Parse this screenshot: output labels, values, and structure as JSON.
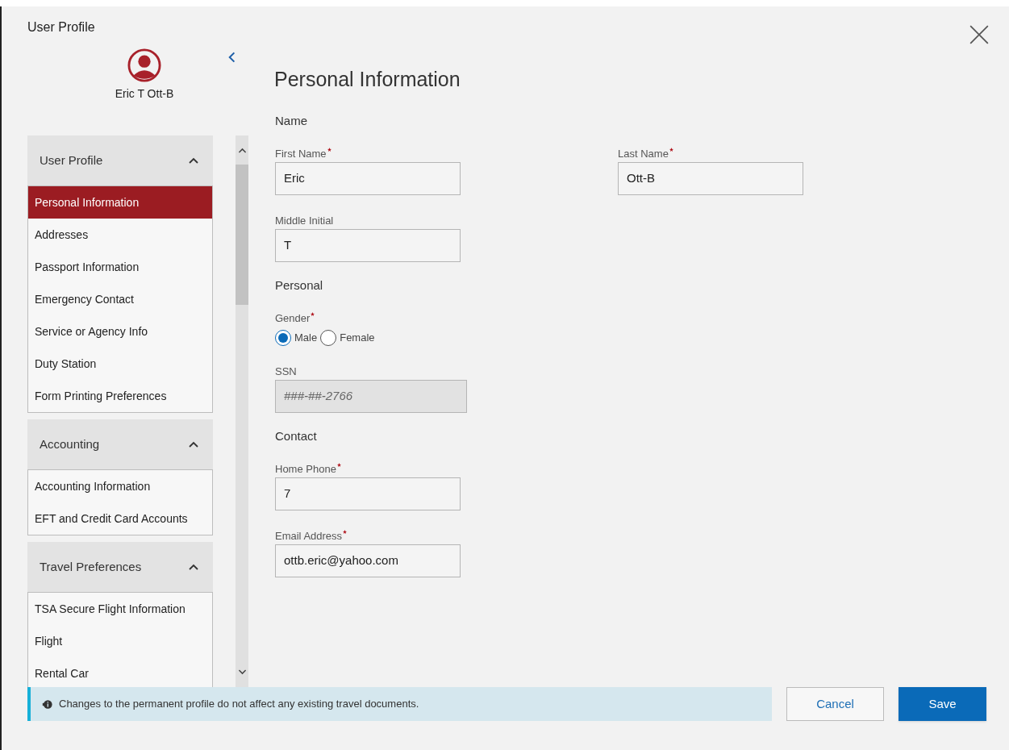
{
  "dialog": {
    "title": "User Profile",
    "user_name": "Eric T Ott-B",
    "heading": "Personal Information"
  },
  "sidebar": {
    "sections": [
      {
        "title": "User Profile",
        "expanded": true,
        "items": [
          {
            "label": "Personal Information",
            "selected": true
          },
          {
            "label": "Addresses",
            "selected": false
          },
          {
            "label": "Passport Information",
            "selected": false
          },
          {
            "label": "Emergency Contact",
            "selected": false
          },
          {
            "label": "Service or Agency Info",
            "selected": false
          },
          {
            "label": "Duty Station",
            "selected": false
          },
          {
            "label": "Form Printing Preferences",
            "selected": false
          }
        ]
      },
      {
        "title": "Accounting",
        "expanded": true,
        "items": [
          {
            "label": "Accounting Information",
            "selected": false
          },
          {
            "label": "EFT and Credit Card Accounts",
            "selected": false
          }
        ]
      },
      {
        "title": "Travel Preferences",
        "expanded": true,
        "items": [
          {
            "label": "TSA Secure Flight Information",
            "selected": false
          },
          {
            "label": "Flight",
            "selected": false
          },
          {
            "label": "Rental Car",
            "selected": false
          }
        ]
      }
    ]
  },
  "form": {
    "groups": [
      {
        "title": "Name",
        "rows": [
          [
            {
              "kind": "text",
              "label": "First Name",
              "required": true,
              "value": "Eric",
              "disabled": false
            },
            {
              "kind": "text",
              "label": "Last Name",
              "required": true,
              "value": "Ott-B",
              "disabled": false
            }
          ],
          [
            {
              "kind": "text",
              "label": "Middle Initial",
              "required": false,
              "value": "T",
              "disabled": false
            }
          ]
        ]
      },
      {
        "title": "Personal",
        "rows": [
          [
            {
              "kind": "radio",
              "label": "Gender",
              "required": true,
              "options": [
                {
                  "label": "Male",
                  "selected": true
                },
                {
                  "label": "Female",
                  "selected": false
                }
              ]
            }
          ],
          [
            {
              "kind": "text",
              "label": "SSN",
              "required": false,
              "value": "###-##-2766",
              "disabled": true
            }
          ]
        ]
      },
      {
        "title": "Contact",
        "rows": [
          [
            {
              "kind": "text",
              "label": "Home Phone",
              "required": true,
              "value": "7",
              "disabled": false
            }
          ],
          [
            {
              "kind": "text",
              "label": "Email Address",
              "required": true,
              "value": "ottb.eric@yahoo.com",
              "disabled": false
            }
          ]
        ]
      }
    ]
  },
  "footer": {
    "notice": "Changes to the permanent profile do not affect any existing travel documents.",
    "buttons": [
      {
        "label": "Cancel",
        "kind": "secondary"
      },
      {
        "label": "Save",
        "kind": "primary"
      }
    ]
  }
}
